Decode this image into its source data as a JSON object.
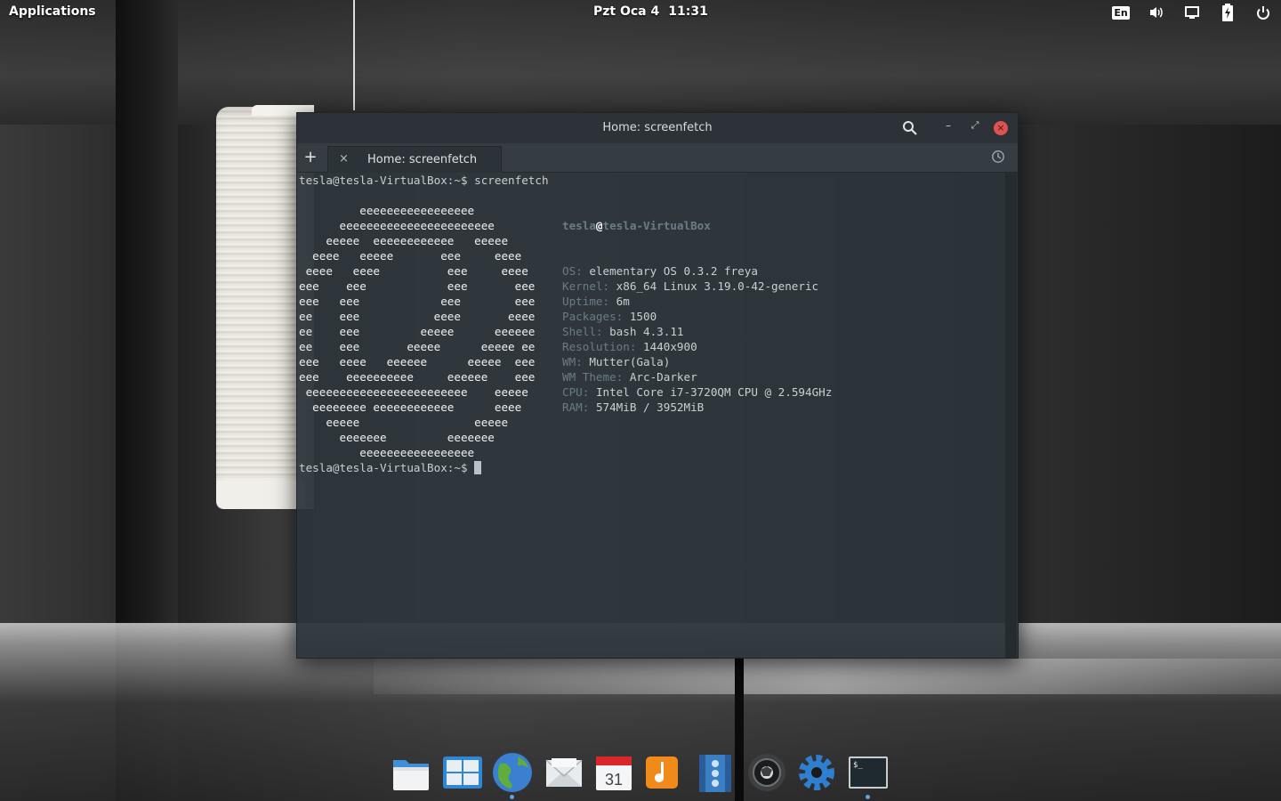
{
  "panel": {
    "applications": "Applications",
    "date": "Pzt Oca  4",
    "time": "11:31",
    "language": "En",
    "indicators": [
      "keyboard-layout",
      "sound",
      "display",
      "battery",
      "power"
    ]
  },
  "window": {
    "title": "Home: screenfetch",
    "tab_label": "Home: screenfetch",
    "add_tab": "+",
    "close_tab": "×",
    "minimize": "–",
    "maximize": "⤢",
    "close": "×"
  },
  "terminal": {
    "command_line": "tesla@tesla-VirtualBox:~$ screenfetch",
    "final_prompt": "tesla@tesla-VirtualBox:~$ ",
    "logo_lines": [
      "",
      "         eeeeeeeeeeeeeeeee",
      "      eeeeeeeeeeeeeeeeeeeeeee",
      "    eeeee  eeeeeeeeeeee   eeeee",
      "  eeee   eeeee       eee     eeee",
      " eeee   eeee          eee     eeee",
      "eee    eee            eee       eee",
      "eee   eee            eee        eee",
      "ee    eee           eeee       eeee",
      "ee    eee         eeeee      eeeeee",
      "ee    eee       eeeee      eeeee ee",
      "eee   eeee   eeeeee      eeeee  eee",
      "eee    eeeeeeeeee     eeeeee    eee",
      " eeeeeeeeeeeeeeeeeeeeeeee    eeeee",
      "  eeeeeeee eeeeeeeeeeee      eeee",
      "    eeeee                 eeeee",
      "      eeeeeee         eeeeeee",
      "         eeeeeeeeeeeeeeeee"
    ],
    "info": {
      "user": "tesla",
      "at": "@",
      "host": "tesla-VirtualBox",
      "lines": [
        {
          "key": "OS:",
          "value": "elementary OS 0.3.2 freya"
        },
        {
          "key": "Kernel:",
          "value": "x86_64 Linux 3.19.0-42-generic"
        },
        {
          "key": "Uptime:",
          "value": "6m"
        },
        {
          "key": "Packages:",
          "value": "1500"
        },
        {
          "key": "Shell:",
          "value": "bash 4.3.11"
        },
        {
          "key": "Resolution:",
          "value": "1440x900"
        },
        {
          "key": "WM:",
          "value": "Mutter(Gala)"
        },
        {
          "key": "WM Theme:",
          "value": "Arc-Darker"
        },
        {
          "key": "CPU:",
          "value": "Intel Core i7-3720QM CPU @ 2.594GHz"
        },
        {
          "key": "RAM:",
          "value": "574MiB / 3952MiB"
        }
      ]
    }
  },
  "calendar_day": "31",
  "dock": [
    {
      "name": "files",
      "icon": "folder-icon",
      "running": false
    },
    {
      "name": "multitasking-view",
      "icon": "multitasking-icon",
      "running": false
    },
    {
      "name": "web-browser",
      "icon": "globe-icon",
      "running": true
    },
    {
      "name": "mail",
      "icon": "mail-icon",
      "running": false
    },
    {
      "name": "calendar",
      "icon": "calendar-icon",
      "running": false
    },
    {
      "name": "music",
      "icon": "music-icon",
      "running": false
    },
    {
      "name": "videos",
      "icon": "video-icon",
      "running": false
    },
    {
      "name": "photos",
      "icon": "camera-icon",
      "running": false
    },
    {
      "name": "system-settings",
      "icon": "gear-icon",
      "running": false
    },
    {
      "name": "terminal",
      "icon": "terminal-icon",
      "running": true
    }
  ],
  "colors": {
    "accent": "#59a5e8",
    "close": "#e05252",
    "terminal_bg": "#2b343a",
    "terminal_key": "#6b7c85"
  }
}
